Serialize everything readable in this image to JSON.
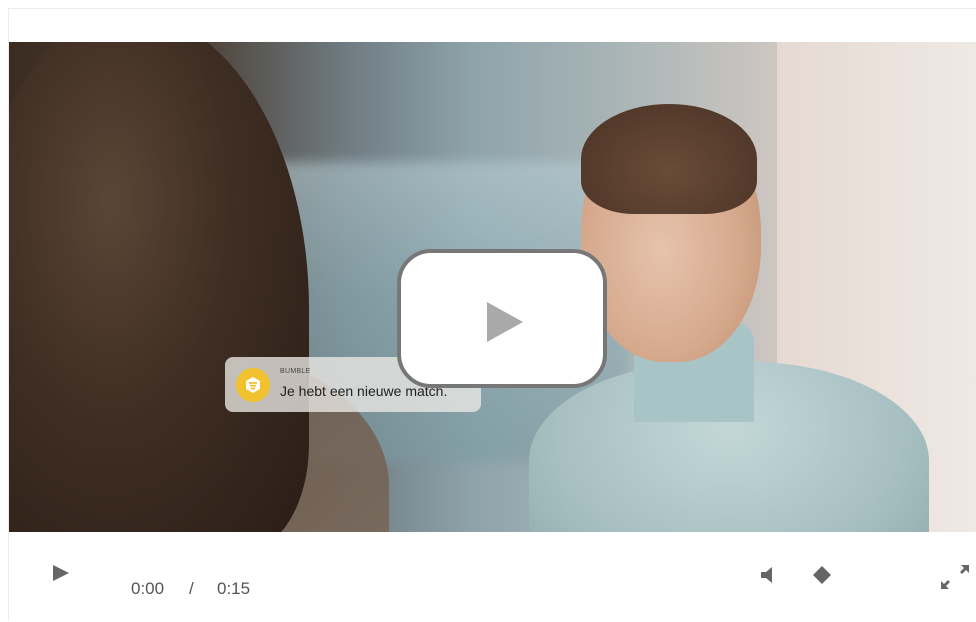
{
  "notification": {
    "app_name": "BUMBLE",
    "message": "Je hebt een nieuwe match."
  },
  "player": {
    "current_time": "0:00",
    "separator": "/",
    "duration": "0:15",
    "progress": 0,
    "icons": {
      "big_play": "play-icon",
      "play": "play-icon",
      "volume": "volume-icon",
      "settings": "diamond-icon",
      "fullscreen": "fullscreen-icon"
    },
    "colors": {
      "control_icon": "#666666",
      "big_play_border": "#777777",
      "notification_icon": "#f2c12e"
    }
  }
}
